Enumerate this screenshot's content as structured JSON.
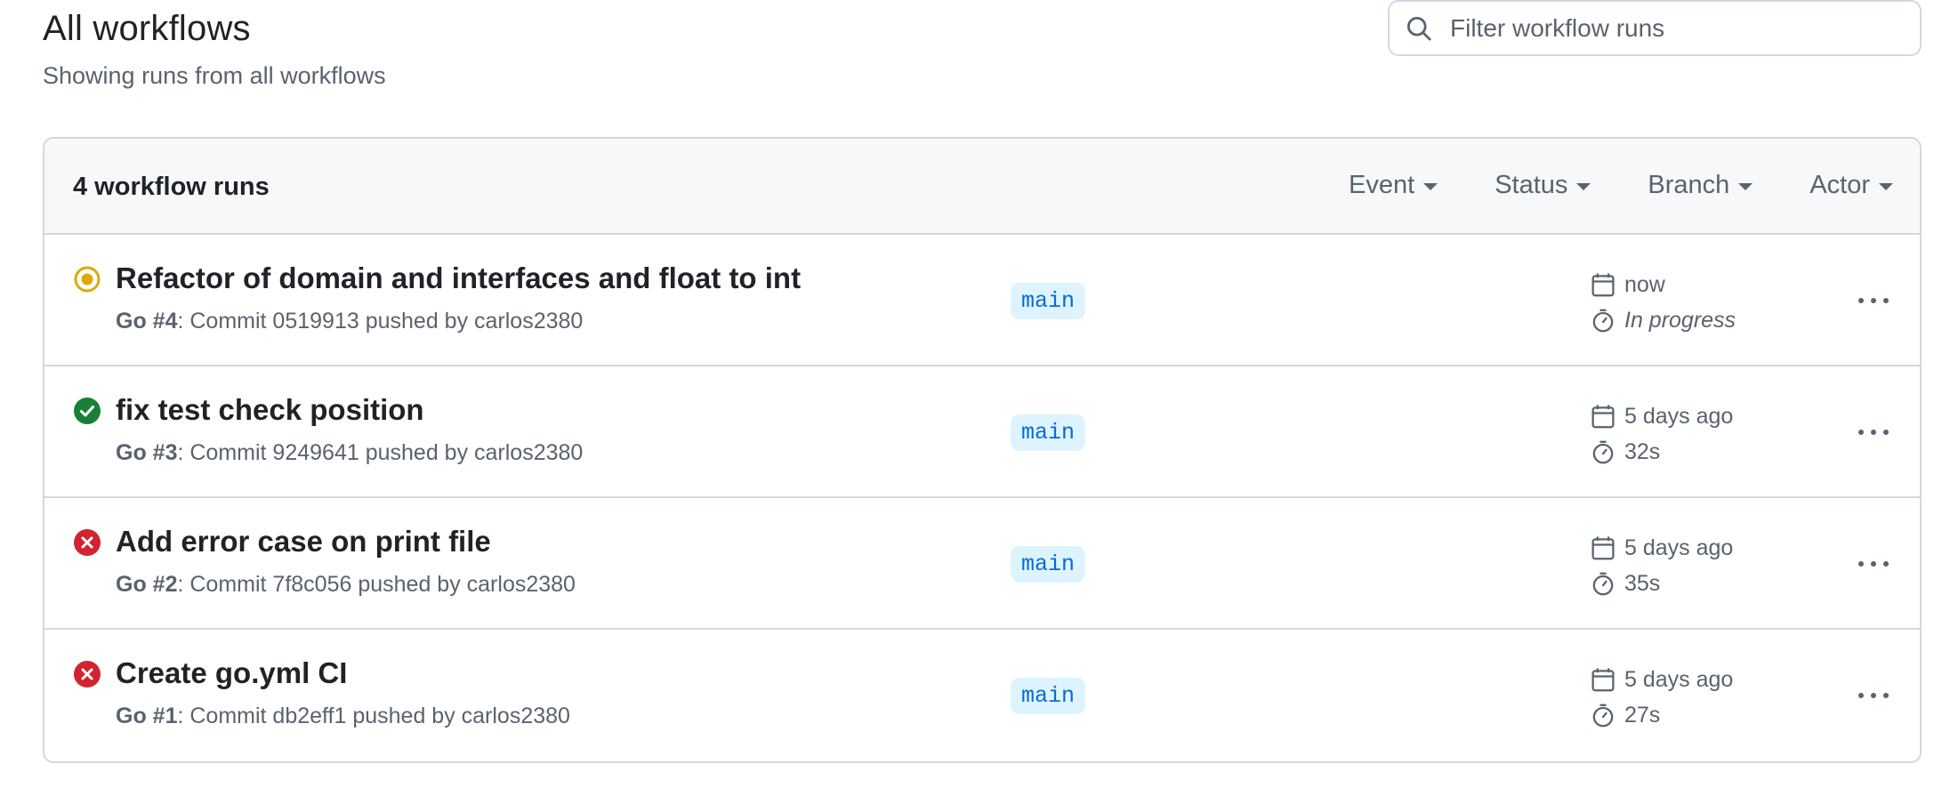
{
  "header": {
    "title": "All workflows",
    "subtitle": "Showing runs from all workflows"
  },
  "search": {
    "placeholder": "Filter workflow runs",
    "value": ""
  },
  "runs_box": {
    "count_label": "4 workflow runs",
    "filters": [
      "Event",
      "Status",
      "Branch",
      "Actor"
    ]
  },
  "runs": [
    {
      "status": "in_progress",
      "title": "Refactor of domain and interfaces and float to int",
      "workflow": "Go #4",
      "meta": ": Commit 0519913 pushed by carlos2380",
      "branch": "main",
      "date": "now",
      "duration": "In progress"
    },
    {
      "status": "success",
      "title": "fix test check position",
      "workflow": "Go #3",
      "meta": ": Commit 9249641 pushed by carlos2380",
      "branch": "main",
      "date": "5 days ago",
      "duration": "32s"
    },
    {
      "status": "failure",
      "title": "Add error case on print file",
      "workflow": "Go #2",
      "meta": ": Commit 7f8c056 pushed by carlos2380",
      "branch": "main",
      "date": "5 days ago",
      "duration": "35s"
    },
    {
      "status": "failure",
      "title": "Create go.yml CI",
      "workflow": "Go #1",
      "meta": ": Commit db2eff1 pushed by carlos2380",
      "branch": "main",
      "date": "5 days ago",
      "duration": "27s"
    }
  ],
  "colors": {
    "in_progress": "#dbab09",
    "success": "#1a7f37",
    "failure": "#d1242f",
    "branch_bg": "#ddf4ff",
    "branch_fg": "#0969da"
  },
  "icons": {
    "search": "search-icon",
    "calendar": "calendar-icon",
    "stopwatch": "stopwatch-icon",
    "more": "kebab-horizontal-icon"
  }
}
